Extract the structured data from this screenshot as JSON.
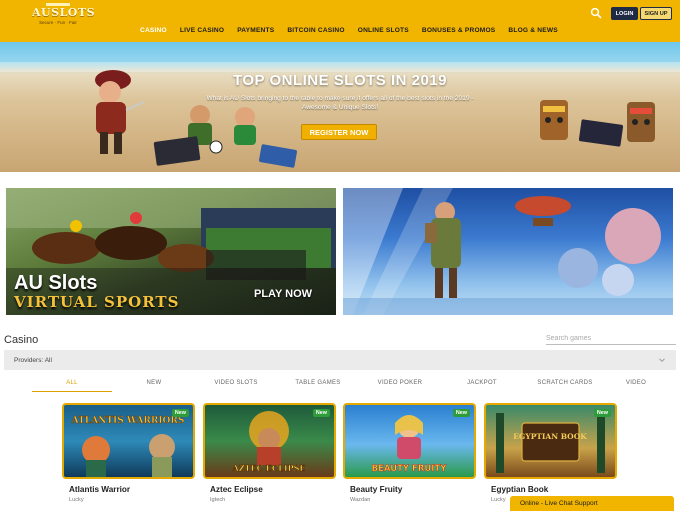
{
  "header": {
    "logo_text": "AUSLOTS",
    "logo_tagline": "Secure · Fun · Fair",
    "nav": [
      {
        "label": "CASINO",
        "active": true
      },
      {
        "label": "LIVE CASINO",
        "active": false
      },
      {
        "label": "PAYMENTS",
        "active": false
      },
      {
        "label": "BITCOIN CASINO",
        "active": false
      },
      {
        "label": "ONLINE SLOTS",
        "active": false
      },
      {
        "label": "BONUSES & PROMOS",
        "active": false
      },
      {
        "label": "BLOG & NEWS",
        "active": false
      }
    ],
    "login_label": "LOGIN",
    "signup_label": "SIGN UP",
    "search_icon": "search-icon"
  },
  "hero": {
    "title": "TOP ONLINE SLOTS IN 2019",
    "subtitle": "What is AU Slots bringing to the table to make sure it offers all of the best slots in the 2019 - Awesome & Unique Slots!",
    "register_label": "REGISTER NOW"
  },
  "promos": {
    "virtual_sports": {
      "title_line1": "AU Slots",
      "title_line2": "VIRTUAL SPORTS",
      "cta": "PLAY NOW"
    }
  },
  "casino": {
    "heading": "Casino",
    "search_placeholder": "Search games",
    "providers_label": "Providers: All",
    "tabs": [
      {
        "label": "ALL",
        "active": true
      },
      {
        "label": "NEW",
        "active": false
      },
      {
        "label": "VIDEO SLOTS",
        "active": false
      },
      {
        "label": "TABLE GAMES",
        "active": false
      },
      {
        "label": "VIDEO POKER",
        "active": false
      },
      {
        "label": "JACKPOT",
        "active": false
      },
      {
        "label": "SCRATCH CARDS",
        "active": false
      },
      {
        "label": "VIDEO",
        "active": false
      }
    ],
    "games": [
      {
        "name": "Atlantis Warrior",
        "provider": "Lucky",
        "badge": "New",
        "art_title": "ATLANTIS WARRIORS"
      },
      {
        "name": "Aztec Eclipse",
        "provider": "Igtech",
        "badge": "New",
        "art_title": "AZTEC ECLIPSE"
      },
      {
        "name": "Beauty Fruity",
        "provider": "Wazdan",
        "badge": "New",
        "art_title": "BEAUTY FRUITY"
      },
      {
        "name": "Egyptian Book",
        "provider": "Lucky",
        "badge": "New",
        "art_title": "EGYPTIAN BOOK"
      }
    ]
  },
  "chat": {
    "label": "Online - Live Chat Support"
  },
  "colors": {
    "brand_yellow": "#f1b500",
    "dark_navy": "#1f2a44",
    "new_badge": "#2e9c3a"
  }
}
